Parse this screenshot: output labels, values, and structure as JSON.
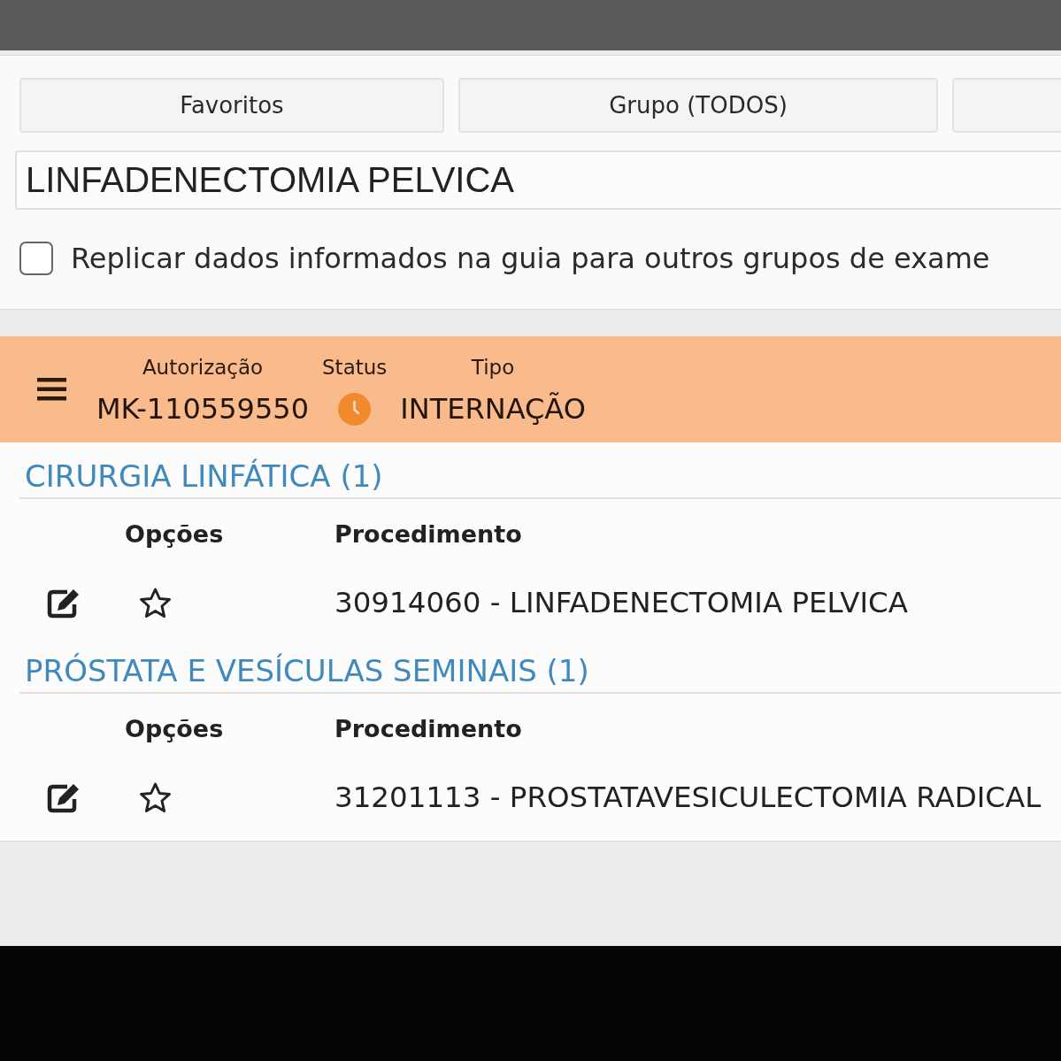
{
  "filter_buttons": [
    {
      "kind": "labeled",
      "label": "Favoritos"
    },
    {
      "kind": "labeled",
      "label": "Grupo (TODOS)"
    },
    {
      "kind": "cut"
    }
  ],
  "search": {
    "value": "LINFADENECTOMIA PELVICA"
  },
  "replicate_option": {
    "label": "Replicar dados informados na guia para outros grupos de exame",
    "checked": false
  },
  "authorization": {
    "fields": [
      {
        "kind": "text",
        "label": "Autorização",
        "value": "MK-110559550"
      },
      {
        "kind": "status",
        "label": "Status",
        "color": "#f08a2c"
      },
      {
        "kind": "text",
        "label": "Tipo",
        "value": "INTERNAÇÃO"
      }
    ]
  },
  "groups": [
    {
      "title": "CIRURGIA LINFÁTICA (1)",
      "columns": [
        "Opções",
        "Procedimento"
      ],
      "rows": [
        {
          "procedure": "30914060 - LINFADENECTOMIA PELVICA",
          "favorite": false
        }
      ]
    },
    {
      "title": "PRÓSTATA E VESÍCULAS SEMINAIS (1)",
      "columns": [
        "Opções",
        "Procedimento"
      ],
      "rows": [
        {
          "procedure": "31201113 - PROSTATAVESICULECTOMIA RADICAL",
          "favorite": false
        }
      ]
    }
  ]
}
